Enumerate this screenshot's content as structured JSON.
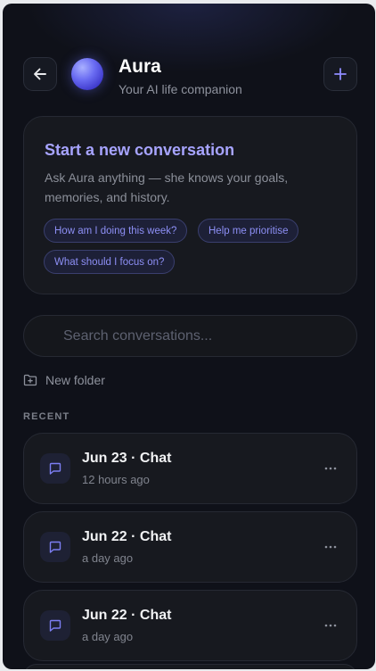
{
  "header": {
    "title": "Aura",
    "subtitle": "Your AI life companion",
    "back_icon": "arrow-left-icon",
    "add_icon": "plus-icon"
  },
  "start_card": {
    "title": "Start a new conversation",
    "description": "Ask Aura anything — she knows your goals, memories, and history.",
    "chips": [
      "How am I doing this week?",
      "Help me prioritise",
      "What should I focus on?"
    ]
  },
  "search": {
    "placeholder": "Search conversations...",
    "value": ""
  },
  "new_folder": {
    "label": "New folder",
    "icon": "folder-plus-icon"
  },
  "recent": {
    "label": "RECENT",
    "items": [
      {
        "title": "Jun 23 · Chat",
        "time": "12 hours ago"
      },
      {
        "title": "Jun 22 · Chat",
        "time": "a day ago"
      },
      {
        "title": "Jun 22 · Chat",
        "time": "a day ago"
      }
    ]
  },
  "colors": {
    "background": "#0c0d12",
    "accent": "#a7a4ff",
    "chip_text": "#8d8ff5",
    "card": "#17191f"
  }
}
